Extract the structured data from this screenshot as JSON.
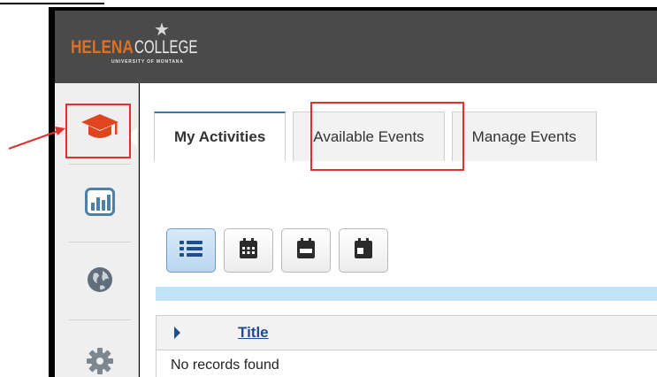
{
  "brand": {
    "name_part1": "HELENA",
    "name_part2": "COLLEGE",
    "subtitle": "UNIVERSITY OF MONTANA",
    "star": "★"
  },
  "colors": {
    "header_bg": "#4a4a4a",
    "brand_orange": "#e07020",
    "accent_blue": "#1f4e8c",
    "annotation_red": "#e03030",
    "strip_blue": "#bfe4f7"
  },
  "sidebar": {
    "items": [
      {
        "icon": "graduation-cap-icon",
        "active": true
      },
      {
        "icon": "bar-chart-icon",
        "active": false
      },
      {
        "icon": "globe-icon",
        "active": false
      },
      {
        "icon": "gear-icon",
        "active": false
      }
    ]
  },
  "tabs": [
    {
      "label": "My Activities",
      "active": true
    },
    {
      "label": "Available Events",
      "active": false
    },
    {
      "label": "Manage Events",
      "active": false
    }
  ],
  "view_buttons": [
    {
      "icon": "list-icon",
      "active": true
    },
    {
      "icon": "calendar-month-icon",
      "active": false
    },
    {
      "icon": "calendar-week-icon",
      "active": false
    },
    {
      "icon": "calendar-day-icon",
      "active": false
    }
  ],
  "grid": {
    "column_title": "Title",
    "empty_message": "No records found"
  }
}
